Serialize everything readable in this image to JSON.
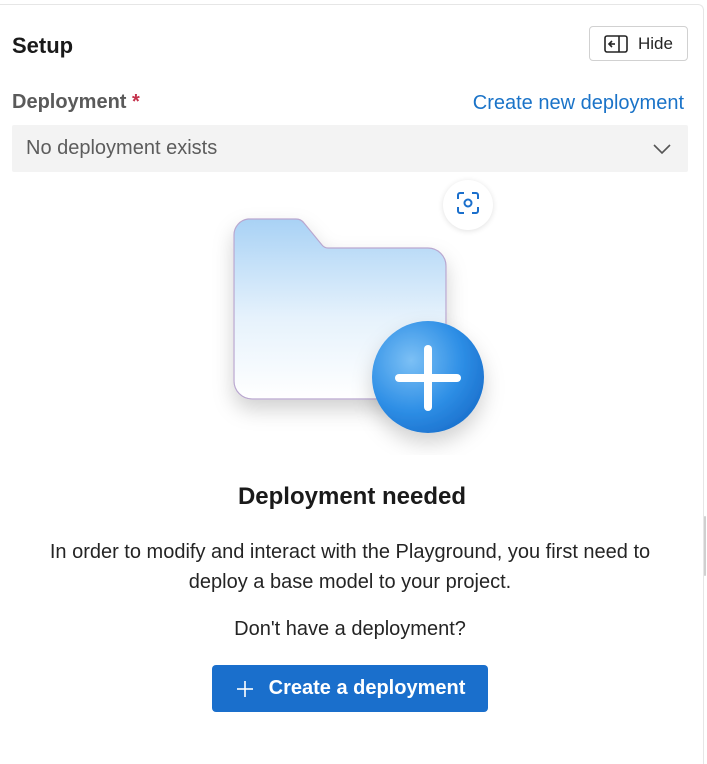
{
  "setup": {
    "title": "Setup",
    "hide_label": "Hide"
  },
  "deployment": {
    "label": "Deployment",
    "required_marker": "*",
    "create_new_link": "Create new deployment",
    "selected_value": "No deployment exists"
  },
  "empty_state": {
    "heading": "Deployment needed",
    "description": "In order to modify and interact with the Playground, you first need to deploy a base model to your project.",
    "question": "Don't have a deployment?",
    "button_label": "Create a deployment"
  },
  "colors": {
    "accent": "#1a6fcc",
    "link": "#1a73c8",
    "required": "#c4314b"
  },
  "icons": {
    "hide": "panel-collapse-icon",
    "dropdown": "chevron-down-icon",
    "scan": "screenshot-scan-icon",
    "illustration": "folder-add-illustration",
    "button": "plus-icon"
  }
}
